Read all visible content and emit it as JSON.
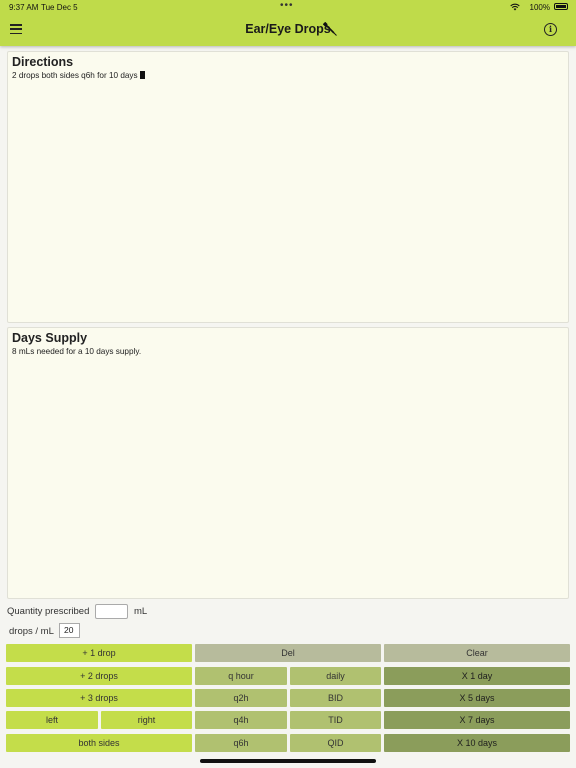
{
  "status_bar": {
    "time": "9:37 AM",
    "date": "Tue Dec 5",
    "dots": "•••",
    "battery": "100%"
  },
  "header": {
    "title": "Ear/Eye Drops",
    "info_symbol": "i"
  },
  "directions": {
    "title": "Directions",
    "text": "2 drops both sides q6h for 10 days"
  },
  "days_supply": {
    "title": "Days Supply",
    "text": "8 mLs needed for a 10 days supply."
  },
  "inputs": {
    "quantity_label": "Quantity prescribed",
    "quantity_value": "",
    "quantity_unit": "mL",
    "drops_per_ml_label": "drops / mL",
    "drops_per_ml_value": "20"
  },
  "buttons": {
    "plus_1_drop": "+ 1 drop",
    "del": "Del",
    "clear": "Clear",
    "plus_2_drops": "+ 2 drops",
    "q_hour": "q hour",
    "daily": "daily",
    "x_1_day": "X 1 day",
    "plus_3_drops": "+ 3 drops",
    "q2h": "q2h",
    "bid": "BID",
    "x_5_days": "X 5 days",
    "left": "left",
    "right": "right",
    "q4h": "q4h",
    "tid": "TID",
    "x_7_days": "X 7 days",
    "both_sides": "both sides",
    "q6h": "q6h",
    "qid": "QID",
    "x_10_days": "X 10 days"
  },
  "colors": {
    "header": "#bfdb4a",
    "button_green": "#c4dd4a",
    "button_gray": "#b7bb9c",
    "button_olive": "#b0c170",
    "button_dark": "#8b9d5b"
  }
}
